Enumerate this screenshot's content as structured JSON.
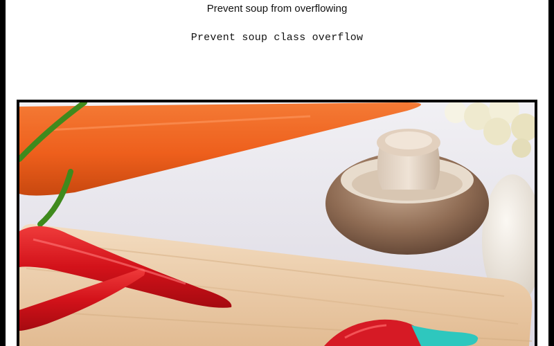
{
  "header": {
    "title": "Prevent soup from overflowing",
    "subtitle": "Prevent soup class overflow"
  },
  "photo": {
    "subject": "vegetables-on-cutting-board"
  },
  "colors": {
    "border": "#000000",
    "background": "#ffffff",
    "carrot": "#f0621f",
    "chili": "#d8121a",
    "board": "#e9c9a4",
    "mushroom": "#8a6a52",
    "accessory_teal": "#2ec7be"
  }
}
